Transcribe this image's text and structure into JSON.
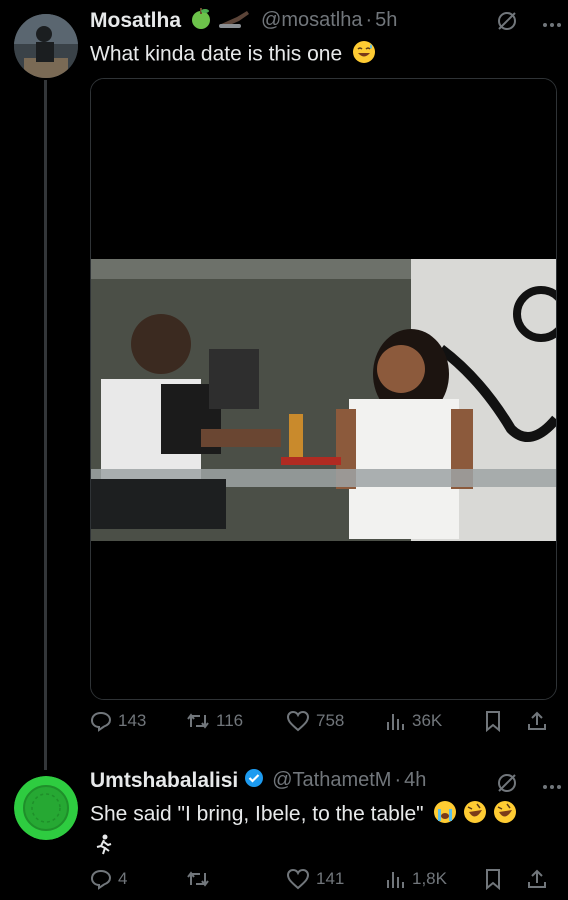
{
  "tweet1": {
    "author_name": "Mosatlha",
    "handle": "@mosatlha",
    "separator": "·",
    "time": "5h",
    "text": "What kinda date is this one",
    "stats": {
      "replies": "143",
      "reposts": "116",
      "likes": "758",
      "views": "36K"
    }
  },
  "tweet2": {
    "author_name": "Umtshabalalisi",
    "handle": "@TathametM",
    "separator": "·",
    "time": "4h",
    "text": "She said \"I bring, Ibele, to the table\"",
    "stats": {
      "replies": "4",
      "reposts": "",
      "likes": "141",
      "views": "1,8K"
    }
  },
  "colors": {
    "background": "#000000",
    "muted": "#71767b",
    "verified": "#1d9bf0",
    "avatar_green": "#2ecc40"
  }
}
